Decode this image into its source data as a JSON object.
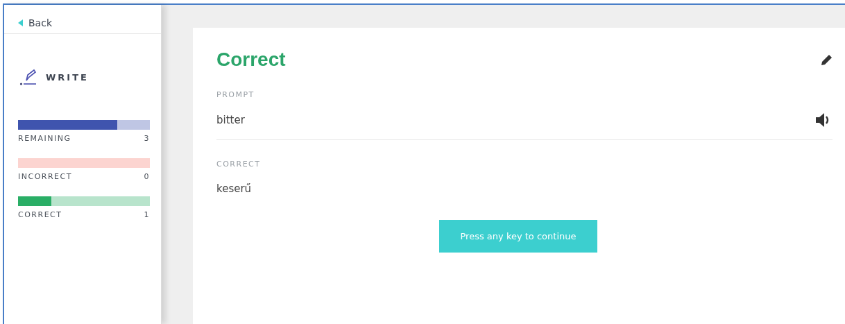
{
  "sidebar": {
    "back": "Back",
    "mode": "WRITE",
    "stats": [
      {
        "label": "REMAINING",
        "count": "3",
        "level": 0.75,
        "color": "#bfc6e4"
      },
      {
        "label": "INCORRECT",
        "count": "0",
        "level": 0,
        "color": "#fcd4d0"
      },
      {
        "label": "CORRECT",
        "count": "1",
        "level": 0.25,
        "color": "#b8e4cc"
      }
    ]
  },
  "result": {
    "title": "Correct",
    "sections": [
      {
        "heading": "PROMPT",
        "text": "bitter",
        "audio": true
      },
      {
        "heading": "CORRECT",
        "text": "keserű",
        "audio": false
      }
    ]
  },
  "continue_button": "Press any key to continue"
}
